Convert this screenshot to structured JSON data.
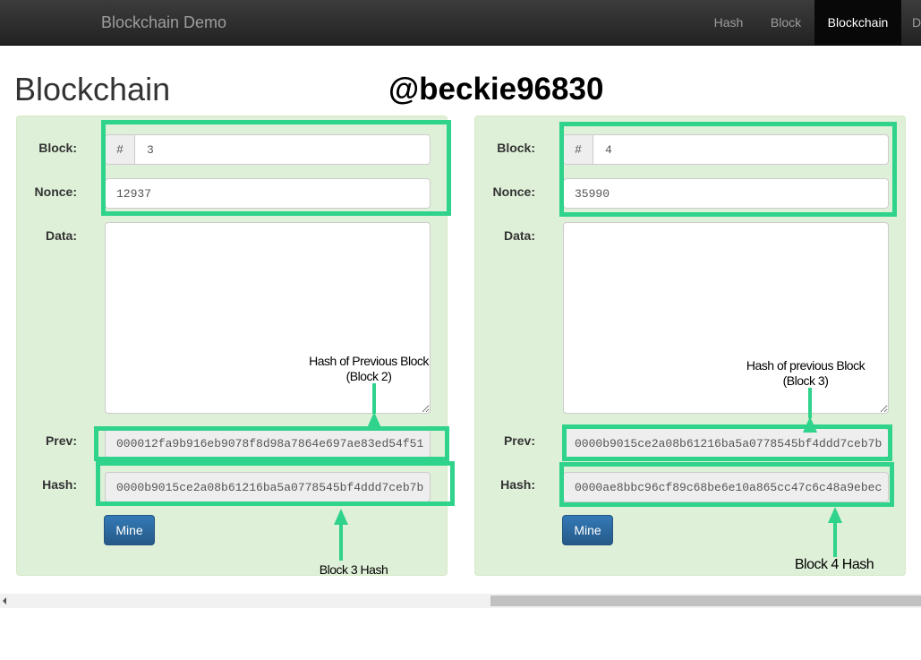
{
  "navbar": {
    "brand": "Blockchain Demo",
    "items": [
      {
        "label": "Hash",
        "active": false
      },
      {
        "label": "Block",
        "active": false
      },
      {
        "label": "Blockchain",
        "active": true
      },
      {
        "label": "D",
        "active": false
      }
    ]
  },
  "page": {
    "title": "Blockchain",
    "watermark": "@beckie96830"
  },
  "labels": {
    "block": "Block:",
    "nonce": "Nonce:",
    "data": "Data:",
    "prev": "Prev:",
    "hash": "Hash:",
    "hash_prefix": "#",
    "mine": "Mine"
  },
  "blocks": [
    {
      "number": "3",
      "nonce": "12937",
      "data": "",
      "prev": "000012fa9b916eb9078f8d98a7864e697ae83ed54f51",
      "hash": "0000b9015ce2a08b61216ba5a0778545bf4ddd7ceb7b"
    },
    {
      "number": "4",
      "nonce": "35990",
      "data": "",
      "prev": "0000b9015ce2a08b61216ba5a0778545bf4ddd7ceb7b",
      "hash": "0000ae8bbc96cf89c68be6e10a865cc47c6c48a9ebec"
    }
  ],
  "annotations": {
    "prev_left_line1": "Hash of Previous Block",
    "prev_left_line2": "(Block 2)",
    "prev_right_line1": "Hash of previous Block",
    "prev_right_line2": "(Block 3)",
    "hash_left": "Block 3 Hash",
    "hash_right": "Block 4 Hash"
  },
  "colors": {
    "highlight": "#2fd38b",
    "card_bg": "#dff0d8",
    "button": "#337ab7",
    "navbar": "#222222"
  },
  "icons": {
    "arrow": "arrow-up-icon",
    "scroll_left": "chevron-left-icon"
  }
}
